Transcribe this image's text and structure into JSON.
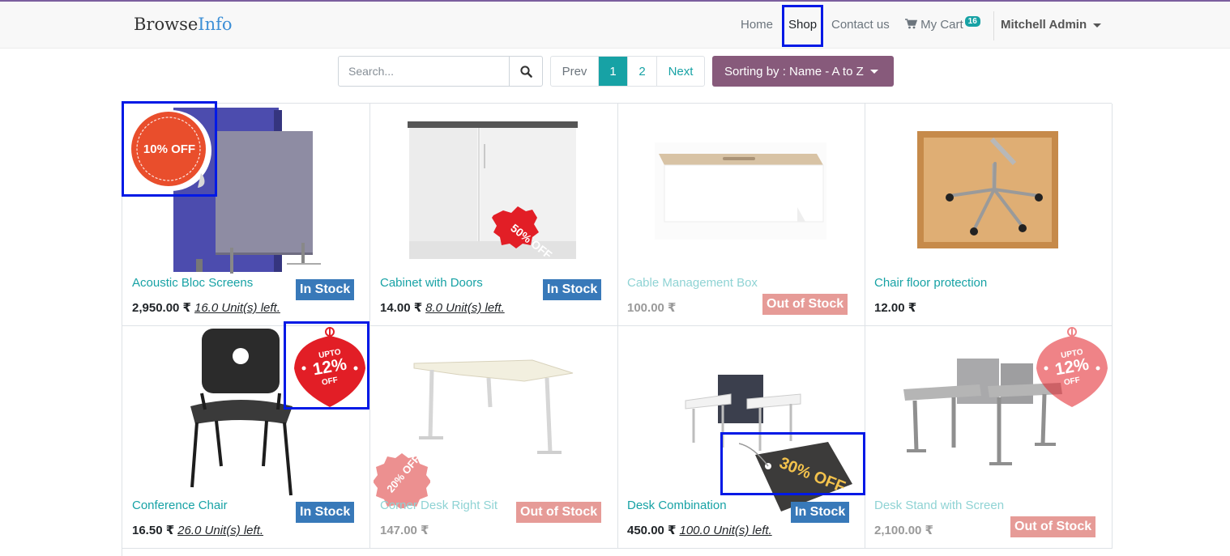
{
  "brand": {
    "part1": "Browse",
    "part2": "Info"
  },
  "nav": {
    "home": "Home",
    "shop": "Shop",
    "contact": "Contact us",
    "cart": "My Cart",
    "cart_count": "16",
    "user": "Mitchell Admin"
  },
  "search": {
    "placeholder": "Search..."
  },
  "pager": {
    "prev": "Prev",
    "p1": "1",
    "p2": "2",
    "next": "Next"
  },
  "sort": {
    "label": "Sorting by : Name - A to Z"
  },
  "colors": {
    "accent": "#17a2a5",
    "sort": "#875a7b",
    "in_stock": "#3879b9",
    "out_stock": "#e69b97",
    "highlight": "#0019e6"
  },
  "products": [
    {
      "name": "Acoustic Bloc Screens",
      "price": "2,950.00 ₹",
      "units": "16.0 Unit(s) left.",
      "stock": "In Stock",
      "badge": "10% OFF"
    },
    {
      "name": "Cabinet with Doors",
      "price": "14.00 ₹",
      "units": "8.0 Unit(s) left.",
      "stock": "In Stock",
      "badge": "50% OFF"
    },
    {
      "name": "Cable Management Box",
      "price": "100.00 ₹",
      "units": "",
      "stock": "Out of Stock",
      "badge": ""
    },
    {
      "name": "Chair floor protection",
      "price": "12.00 ₹",
      "units": "",
      "stock": "",
      "badge": ""
    },
    {
      "name": "Conference Chair",
      "price": "16.50 ₹",
      "units": "26.0 Unit(s) left.",
      "stock": "In Stock",
      "badge_top": "UPTO",
      "badge_num": "12%",
      "badge_bottom": "OFF"
    },
    {
      "name": "Corner Desk Right Sit",
      "price": "147.00 ₹",
      "units": "",
      "stock": "Out of Stock",
      "badge": "20% OFF"
    },
    {
      "name": "Desk Combination",
      "price": "450.00 ₹",
      "units": "100.0 Unit(s) left.",
      "stock": "In Stock",
      "badge": "30% OFF"
    },
    {
      "name": "Desk Stand with Screen",
      "price": "2,100.00 ₹",
      "units": "",
      "stock": "Out of Stock",
      "badge_top": "UPTO",
      "badge_num": "12%",
      "badge_bottom": "OFF"
    }
  ]
}
